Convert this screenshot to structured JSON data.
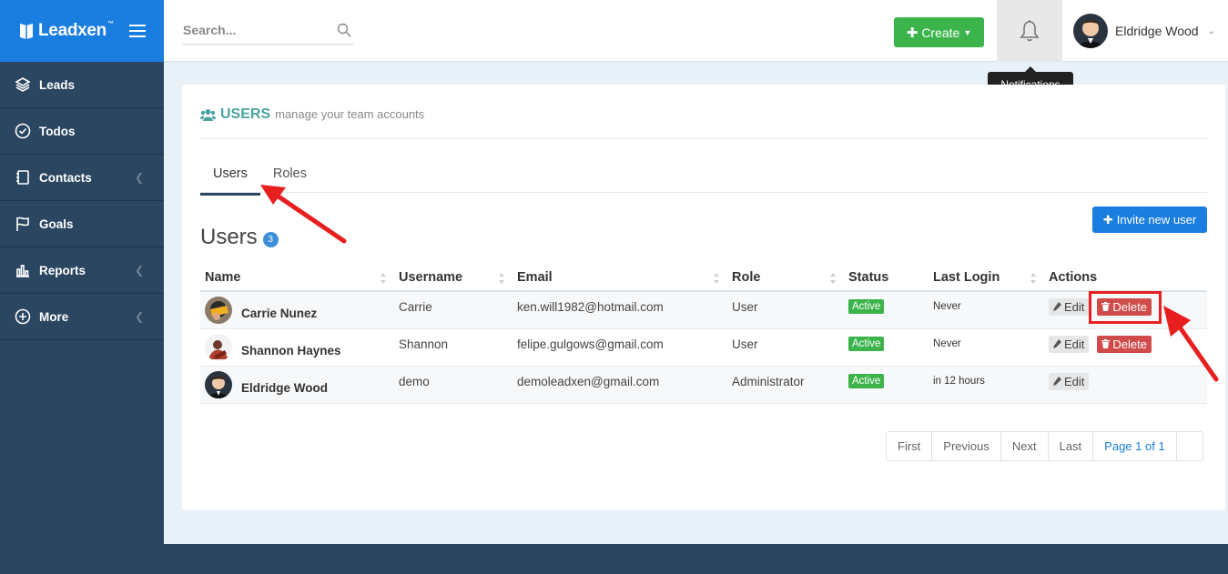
{
  "brand": {
    "name": "Leadxen",
    "tm": "™"
  },
  "sidebar": {
    "items": [
      {
        "label": "Leads",
        "icon": "layers-icon",
        "has_submenu": false
      },
      {
        "label": "Todos",
        "icon": "check-circle-icon",
        "has_submenu": false
      },
      {
        "label": "Contacts",
        "icon": "address-book-icon",
        "has_submenu": true
      },
      {
        "label": "Goals",
        "icon": "flag-icon",
        "has_submenu": false
      },
      {
        "label": "Reports",
        "icon": "bar-chart-icon",
        "has_submenu": true
      },
      {
        "label": "More",
        "icon": "plus-circle-icon",
        "has_submenu": true
      }
    ]
  },
  "header": {
    "search_placeholder": "Search...",
    "create_label": "Create",
    "user_name": "Eldridge Wood",
    "tooltip": "Notifications"
  },
  "page": {
    "title": "USERS",
    "subtitle": "manage your team accounts",
    "tabs": [
      {
        "label": "Users",
        "active": true
      },
      {
        "label": "Roles",
        "active": false
      }
    ],
    "users_heading": "Users",
    "users_count": "3",
    "invite_label": "Invite new user"
  },
  "table": {
    "columns": [
      "Name",
      "Username",
      "Email",
      "Role",
      "Status",
      "Last Login",
      "Actions"
    ],
    "rows": [
      {
        "name": "Carrie Nunez",
        "username": "Carrie",
        "email": "ken.will1982@hotmail.com",
        "role": "User",
        "status": "Active",
        "last_login": "Never",
        "edit": "Edit",
        "delete": "Delete"
      },
      {
        "name": "Shannon Haynes",
        "username": "Shannon",
        "email": "felipe.gulgows@gmail.com",
        "role": "User",
        "status": "Active",
        "last_login": "Never",
        "edit": "Edit",
        "delete": "Delete"
      },
      {
        "name": "Eldridge Wood",
        "username": "demo",
        "email": "demoleadxen@gmail.com",
        "role": "Administrator",
        "status": "Active",
        "last_login": "in 12 hours",
        "edit": "Edit"
      }
    ]
  },
  "pagination": {
    "first": "First",
    "previous": "Previous",
    "next": "Next",
    "last": "Last",
    "page_info": "Page 1 of 1"
  },
  "colors": {
    "sidebar": "#2b4660",
    "brand": "#1a7de0",
    "create": "#3cb44b",
    "delete": "#cf4c4a",
    "highlight": "#e81f1f",
    "title": "#4aa3a0"
  }
}
